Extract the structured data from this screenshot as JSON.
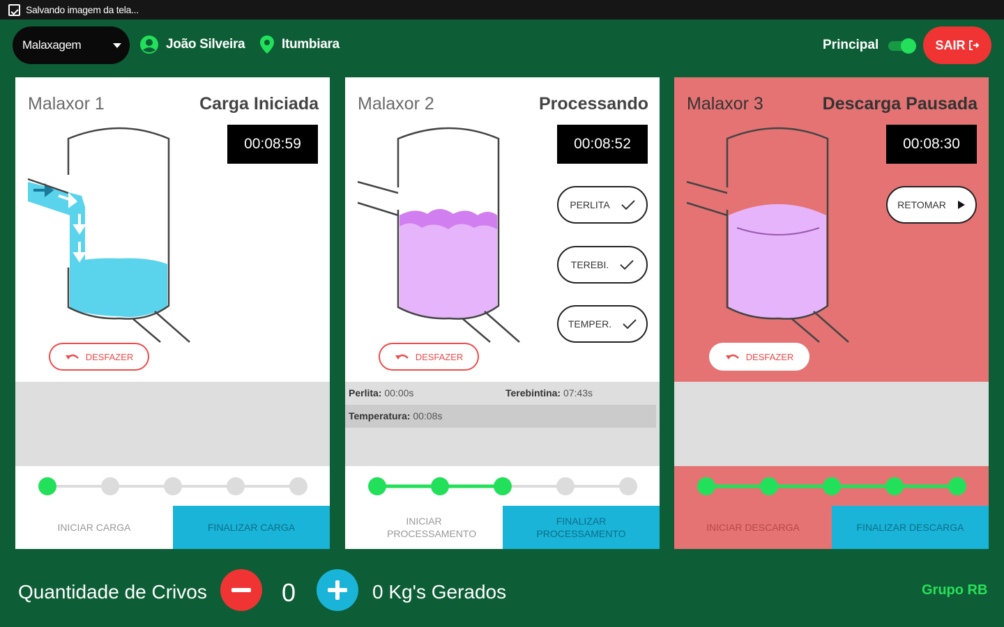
{
  "statusbar": {
    "text": "Salvando imagem da tela..."
  },
  "header": {
    "sector_select": "Malaxagem",
    "user_name": "João Silveira",
    "location": "Itumbiara",
    "principal_label": "Principal",
    "principal_on": true,
    "logout_label": "SAIR"
  },
  "colors": {
    "background": "#0d5e36",
    "accent_green": "#23e05a",
    "danger_red": "#f03434",
    "cyan": "#1ab4d8",
    "liquid_blue": "#5ad4ec",
    "liquid_purple": "#e6b4fa",
    "paused_card": "#e57373"
  },
  "cards": [
    {
      "name": "Malaxor 1",
      "status": "Carga Iniciada",
      "timer": "00:08:59",
      "undo_label": "DESFAZER",
      "progress_step": 1,
      "steps_total": 5,
      "start_label": "INICIAR CARGA",
      "finish_label": "FINALIZAR CARGA"
    },
    {
      "name": "Malaxor 2",
      "status": "Processando",
      "timer": "00:08:52",
      "undo_label": "DESFAZER",
      "checks": [
        "PERLITA",
        "TEREBI.",
        "TEMPER."
      ],
      "info": {
        "perlita_label": "Perlita:",
        "perlita_value": "00:00s",
        "terebintina_label": "Terebintina:",
        "terebintina_value": "07:43s",
        "temperatura_label": "Temperatura:",
        "temperatura_value": "00:08s"
      },
      "progress_step": 3,
      "steps_total": 5,
      "start_label": "INICIAR PROCESSAMENTO",
      "finish_label": "FINALIZAR PROCESSAMENTO"
    },
    {
      "name": "Malaxor 3",
      "status": "Descarga Pausada",
      "timer": "00:08:30",
      "undo_label": "DESFAZER",
      "resume_label": "RETOMAR",
      "progress_step": 5,
      "steps_total": 5,
      "start_label": "INICIAR DESCARGA",
      "finish_label": "FINALIZAR DESCARGA"
    }
  ],
  "footer": {
    "quantity_label": "Quantidade de Crivos",
    "quantity": "0",
    "generated": "0 Kg's Gerados",
    "brand": "Grupo RB"
  }
}
